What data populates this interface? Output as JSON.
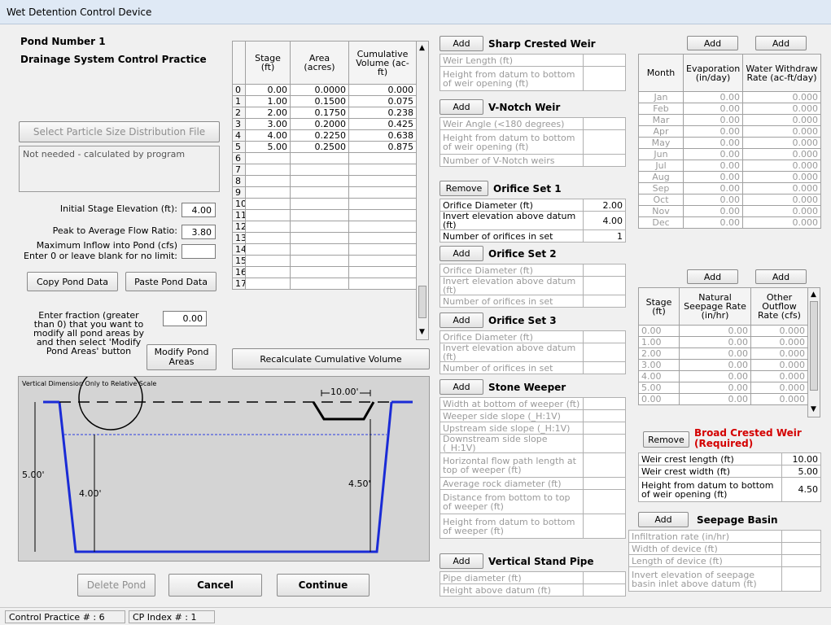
{
  "window": {
    "title": "Wet Detention Control Device"
  },
  "header": {
    "pond_number": "Pond Number 1",
    "subtitle": "Drainage System Control Practice"
  },
  "particle": {
    "button": "Select Particle Size Distribution File",
    "note": "Not needed - calculated by program"
  },
  "inputs": {
    "initial_stage_label": "Initial Stage Elevation (ft):",
    "initial_stage": "4.00",
    "peak_ratio_label": "Peak to Average Flow Ratio:",
    "peak_ratio": "3.80",
    "max_inflow_label_1": "Maximum Inflow into Pond (cfs)",
    "max_inflow_label_2": "Enter 0 or leave blank for no limit:",
    "max_inflow": "",
    "fraction_label": [
      "Enter fraction (greater",
      "than 0) that you want to",
      "modify all pond areas by",
      "and then select 'Modify",
      "Pond Areas' button"
    ],
    "fraction": "0.00"
  },
  "buttons": {
    "copy": "Copy Pond Data",
    "paste": "Paste Pond Data",
    "modify_1": "Modify Pond",
    "modify_2": "Areas",
    "recalc": "Recalculate Cumulative Volume",
    "delete": "Delete Pond",
    "cancel": "Cancel",
    "continue": "Continue",
    "add": "Add",
    "remove": "Remove"
  },
  "stage_table": {
    "headers": [
      "Stage (ft)",
      "Area (acres)",
      "Cumulative Volume (ac-ft)"
    ],
    "rows": [
      [
        "0",
        "0.00",
        "0.0000",
        "0.000"
      ],
      [
        "1",
        "1.00",
        "0.1500",
        "0.075"
      ],
      [
        "2",
        "2.00",
        "0.1750",
        "0.238"
      ],
      [
        "3",
        "3.00",
        "0.2000",
        "0.425"
      ],
      [
        "4",
        "4.00",
        "0.2250",
        "0.638"
      ],
      [
        "5",
        "5.00",
        "0.2500",
        "0.875"
      ],
      [
        "6",
        "",
        "",
        ""
      ],
      [
        "7",
        "",
        "",
        ""
      ],
      [
        "8",
        "",
        "",
        ""
      ],
      [
        "9",
        "",
        "",
        ""
      ],
      [
        "10",
        "",
        "",
        ""
      ],
      [
        "11",
        "",
        "",
        ""
      ],
      [
        "12",
        "",
        "",
        ""
      ],
      [
        "13",
        "",
        "",
        ""
      ],
      [
        "14",
        "",
        "",
        ""
      ],
      [
        "15",
        "",
        "",
        ""
      ],
      [
        "16",
        "",
        "",
        ""
      ],
      [
        "17",
        "",
        "",
        ""
      ]
    ]
  },
  "diagram": {
    "caption": "Vertical Dimension Only to Relative Scale",
    "dim_depth": "5.00'",
    "dim_stage": "4.00'",
    "dim_weir_height": "4.50'",
    "dim_weir_width": "10.00'"
  },
  "chart_data": {
    "type": "diagram",
    "title": "Vertical Dimension Only to Relative Scale",
    "pond_depth_ft": 5.0,
    "initial_stage_ft": 4.0,
    "broad_crested_weir_height_ft": 4.5,
    "broad_crested_weir_length_ft": 10.0
  },
  "outlets": {
    "sharp_crested": {
      "title": "Sharp Crested Weir",
      "rows": [
        "Weir Length (ft)",
        "Height from datum to bottom of weir opening (ft)"
      ]
    },
    "v_notch": {
      "title": "V-Notch Weir",
      "rows": [
        "Weir Angle (<180 degrees)",
        "Height from datum to bottom of weir opening (ft)",
        "Number of V-Notch weirs"
      ]
    },
    "orifice1": {
      "title": "Orifice Set 1",
      "rows": [
        {
          "label": "Orifice Diameter (ft)",
          "value": "2.00"
        },
        {
          "label": "Invert elevation above datum (ft)",
          "value": "4.00"
        },
        {
          "label": "Number of orifices in set",
          "value": "1"
        }
      ]
    },
    "orifice2": {
      "title": "Orifice Set 2",
      "rows": [
        "Orifice Diameter (ft)",
        "Invert elevation above datum (ft)",
        "Number of orifices in set"
      ]
    },
    "orifice3": {
      "title": "Orifice Set 3",
      "rows": [
        "Orifice Diameter (ft)",
        "Invert elevation above datum (ft)",
        "Number of orifices in set"
      ]
    },
    "stone_weeper": {
      "title": "Stone Weeper",
      "rows": [
        "Width at bottom of weeper (ft)",
        "Weeper side slope (_H:1V)",
        "Upstream side slope (_H:1V)",
        "Downstream side slope (_H:1V)",
        "Horizontal flow path length at top of weeper (ft)",
        "Average rock diameter (ft)",
        "Distance from bottom to top of weeper (ft)",
        "Height from datum to bottom of weeper (ft)"
      ]
    },
    "stand_pipe": {
      "title": "Vertical Stand Pipe",
      "rows": [
        "Pipe diameter (ft)",
        "Height above datum (ft)"
      ]
    }
  },
  "monthly": {
    "headers": [
      "Month",
      "Evaporation (in/day)",
      "Water Withdraw Rate (ac-ft/day)"
    ],
    "rows": [
      [
        "Jan",
        "0.00",
        "0.000"
      ],
      [
        "Feb",
        "0.00",
        "0.000"
      ],
      [
        "Mar",
        "0.00",
        "0.000"
      ],
      [
        "Apr",
        "0.00",
        "0.000"
      ],
      [
        "May",
        "0.00",
        "0.000"
      ],
      [
        "Jun",
        "0.00",
        "0.000"
      ],
      [
        "Jul",
        "0.00",
        "0.000"
      ],
      [
        "Aug",
        "0.00",
        "0.000"
      ],
      [
        "Sep",
        "0.00",
        "0.000"
      ],
      [
        "Oct",
        "0.00",
        "0.000"
      ],
      [
        "Nov",
        "0.00",
        "0.000"
      ],
      [
        "Dec",
        "0.00",
        "0.000"
      ]
    ]
  },
  "seepage_table": {
    "headers": [
      "Stage (ft)",
      "Natural Seepage Rate (in/hr)",
      "Other Outflow Rate (cfs)"
    ],
    "rows": [
      [
        "0.00",
        "0.00",
        "0.000"
      ],
      [
        "1.00",
        "0.00",
        "0.000"
      ],
      [
        "2.00",
        "0.00",
        "0.000"
      ],
      [
        "3.00",
        "0.00",
        "0.000"
      ],
      [
        "4.00",
        "0.00",
        "0.000"
      ],
      [
        "5.00",
        "0.00",
        "0.000"
      ],
      [
        "0.00",
        "0.00",
        "0.000"
      ]
    ]
  },
  "broad_weir": {
    "title": "Broad Crested Weir",
    "required": "(Required)",
    "rows": [
      {
        "label": "Weir crest length (ft)",
        "value": "10.00"
      },
      {
        "label": "Weir crest width (ft)",
        "value": "5.00"
      },
      {
        "label": "Height from datum to bottom of weir opening (ft)",
        "value": "4.50"
      }
    ]
  },
  "seepage_basin": {
    "title": "Seepage Basin",
    "rows": [
      "Infiltration rate (in/hr)",
      "Width of device (ft)",
      "Length of device (ft)",
      "Invert elevation of seepage basin inlet above datum (ft)"
    ]
  },
  "status": {
    "cp_number": "Control Practice # : 6",
    "cp_index": "CP Index # : 1"
  }
}
